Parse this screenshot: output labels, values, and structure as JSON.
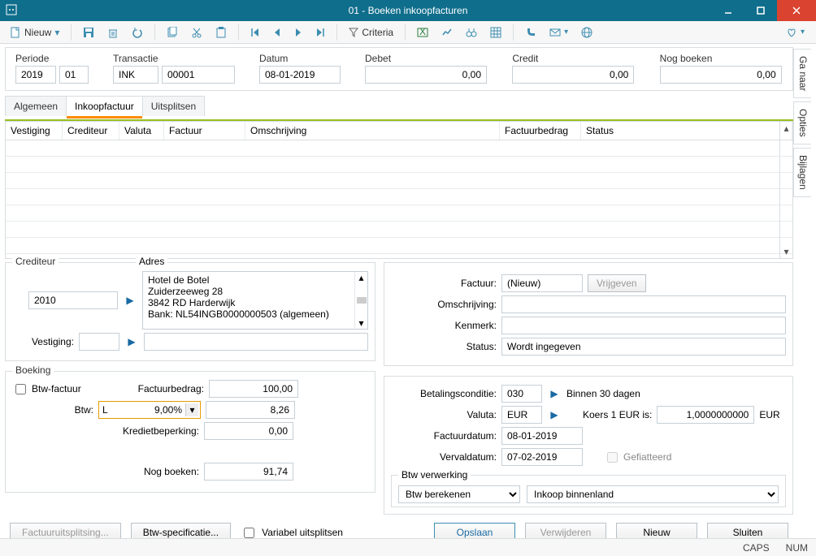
{
  "window": {
    "title": "01 - Boeken inkoopfacturen"
  },
  "toolbar": {
    "nieuw": "Nieuw",
    "criteria": "Criteria"
  },
  "header": {
    "periode_label": "Periode",
    "periode_year": "2019",
    "periode_month": "01",
    "transactie_label": "Transactie",
    "transactie_type": "INK",
    "transactie_nr": "00001",
    "datum_label": "Datum",
    "datum": "08-01-2019",
    "debet_label": "Debet",
    "debet": "0,00",
    "credit_label": "Credit",
    "credit": "0,00",
    "nog_label": "Nog boeken",
    "nog": "0,00"
  },
  "tabs": {
    "algemeen": "Algemeen",
    "inkoop": "Inkoopfactuur",
    "uitsplitsen": "Uitsplitsen"
  },
  "grid": {
    "cols": [
      "Vestiging",
      "Crediteur",
      "Valuta",
      "Factuur",
      "Omschrijving",
      "Factuurbedrag",
      "Status"
    ]
  },
  "crediteur": {
    "legend": "Crediteur",
    "adres_legend": "Adres",
    "code": "2010",
    "adres_lines": [
      "Hotel de Botel",
      "Zuiderzeeweg 28",
      "3842 RD  Harderwijk",
      "Bank: NL54INGB0000000503 (algemeen)"
    ],
    "vestiging_label": "Vestiging:"
  },
  "factuur": {
    "label": "Factuur:",
    "value": "(Nieuw)",
    "vrijgeven": "Vrijgeven",
    "omschrijving_label": "Omschrijving:",
    "omschrijving": "",
    "kenmerk_label": "Kenmerk:",
    "kenmerk": "",
    "status_label": "Status:",
    "status": "Wordt ingegeven"
  },
  "boeking": {
    "legend": "Boeking",
    "btw_factuur_label": "Btw-factuur",
    "factuurbedrag_label": "Factuurbedrag:",
    "factuurbedrag": "100,00",
    "btw_label": "Btw:",
    "btw_code": "L",
    "btw_rate": "9,00%",
    "btw_amount": "8,26",
    "kredietbeperking_label": "Kredietbeperking:",
    "kredietbeperking": "0,00",
    "nog_boeken_label": "Nog boeken:",
    "nog_boeken": "91,74"
  },
  "betaling": {
    "conditie_label": "Betalingsconditie:",
    "conditie_code": "030",
    "conditie_tekst": "Binnen 30 dagen",
    "valuta_label": "Valuta:",
    "valuta": "EUR",
    "koers_label": "Koers 1 EUR is:",
    "koers": "1,0000000000",
    "koers_unit": "EUR",
    "factuurdatum_label": "Factuurdatum:",
    "factuurdatum": "08-01-2019",
    "vervaldatum_label": "Vervaldatum:",
    "vervaldatum": "07-02-2019",
    "gefiatteerd_label": "Gefiatteerd",
    "btw_verwerking_legend": "Btw verwerking",
    "btw_mode": "Btw berekenen",
    "btw_scope": "Inkoop binnenland"
  },
  "footer": {
    "factuuruitsplitsing": "Factuuruitsplitsing...",
    "btw_specificatie": "Btw-specificatie...",
    "variabel_uitsplitsen": "Variabel uitsplitsen",
    "opslaan": "Opslaan",
    "verwijderen": "Verwijderen",
    "nieuw": "Nieuw",
    "sluiten": "Sluiten"
  },
  "sidetabs": {
    "ga_naar": "Ga naar",
    "opties": "Opties",
    "bijlagen": "Bijlagen"
  },
  "status": {
    "caps": "CAPS",
    "num": "NUM"
  }
}
